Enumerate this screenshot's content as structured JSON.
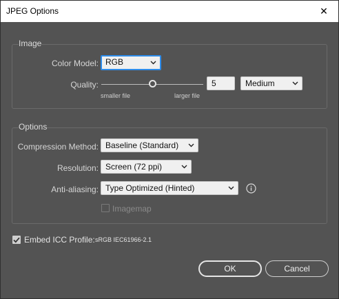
{
  "window": {
    "title": "JPEG Options",
    "close_symbol": "✕"
  },
  "image_group": {
    "title": "Image",
    "color_model_label": "Color Model:",
    "color_model_value": "RGB",
    "quality_label": "Quality:",
    "quality_number": "5",
    "quality_level": "Medium",
    "quality_slider_fraction": 0.5,
    "smaller_file_label": "smaller file",
    "larger_file_label": "larger file"
  },
  "options_group": {
    "title": "Options",
    "compression_label": "Compression Method:",
    "compression_value": "Baseline (Standard)",
    "resolution_label": "Resolution:",
    "resolution_value": "Screen (72 ppi)",
    "antialias_label": "Anti-aliasing:",
    "antialias_value": "Type Optimized (Hinted)",
    "imagemap_label": "Imagemap",
    "imagemap_checked": false,
    "imagemap_enabled": false
  },
  "icc": {
    "label": "Embed ICC Profile:",
    "profile": "sRGB IEC61966-2.1",
    "checked": true
  },
  "buttons": {
    "ok": "OK",
    "cancel": "Cancel"
  },
  "colors": {
    "background": "#535353",
    "focus_accent": "#2d8ceb",
    "title_bar": "#ffffff"
  },
  "icons": {
    "dropdown": "chevron-down-icon",
    "info": "info-icon",
    "check": "checkmark-icon",
    "close": "close-icon"
  }
}
